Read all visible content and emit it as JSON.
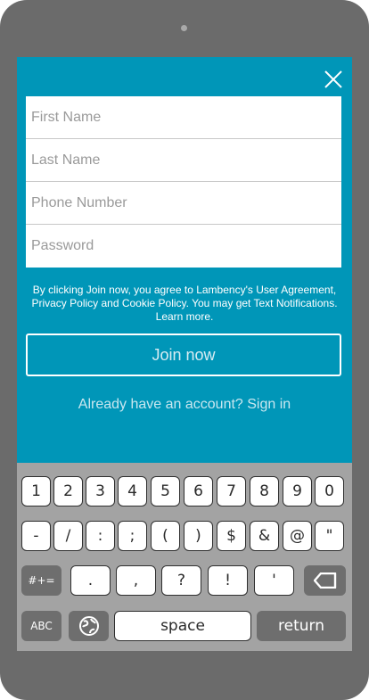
{
  "form": {
    "first_name_placeholder": "First Name",
    "last_name_placeholder": "Last Name",
    "phone_placeholder": "Phone Number",
    "password_placeholder": "Password"
  },
  "terms": {
    "line1": "By clicking Join now, you agree to Lambency's User Agreement,",
    "line2": "Privacy Policy and Cookie Policy. You may get Text Notifications.",
    "line3": "Learn more."
  },
  "join_label": "Join now",
  "signin_label": "Already have an account? Sign in",
  "keyboard": {
    "row1": [
      "1",
      "2",
      "3",
      "4",
      "5",
      "6",
      "7",
      "8",
      "9",
      "0"
    ],
    "row2": [
      "-",
      "/",
      ":",
      ";",
      "(",
      ")",
      "$",
      "&",
      "@",
      "\""
    ],
    "symbols_key": "#+=",
    "row3": [
      ".",
      ",",
      "?",
      "!",
      "'"
    ],
    "abc_key": "ABC",
    "space_key": "space",
    "return_key": "return"
  },
  "icons": {
    "close": "close-icon",
    "backspace": "backspace-icon",
    "globe": "globe-icon"
  }
}
